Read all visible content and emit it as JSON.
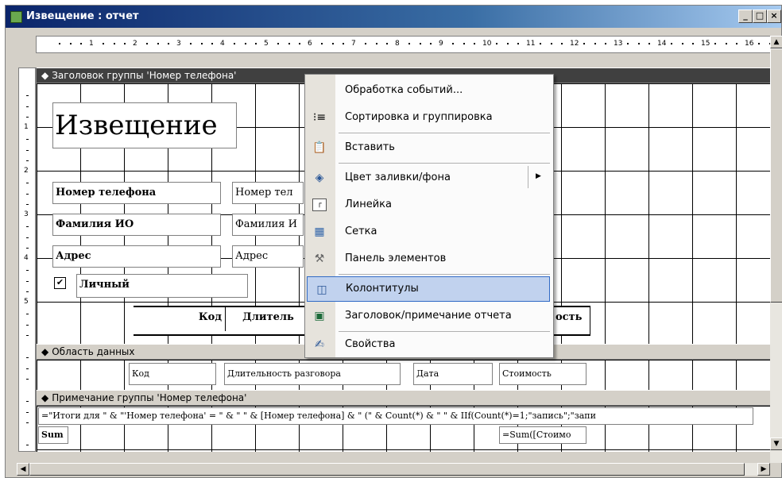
{
  "window": {
    "title": "Извещение : отчет",
    "minimize": "_",
    "maximize": "□",
    "close": "×"
  },
  "ruler": {
    "h_numbers": [
      "1",
      "2",
      "3",
      "4",
      "5",
      "6",
      "7",
      "8",
      "9",
      "10",
      "11",
      "12",
      "13",
      "14",
      "15",
      "16"
    ],
    "v_numbers": [
      "1",
      "2",
      "3",
      "4",
      "5"
    ]
  },
  "sections": {
    "group_header": "Заголовок группы 'Номер телефона'",
    "detail": "Область данных",
    "group_footer": "Примечание группы 'Номер телефона'"
  },
  "header_controls": {
    "title": "Извещение",
    "phone_label": "Номер телефона",
    "phone_field": "Номер тел",
    "name_label": "Фамилия ИО",
    "name_field": "Фамилия И",
    "address_label": "Адрес",
    "address_field": "Адрес",
    "personal_checkbox": "✔",
    "personal_label": "Личный",
    "col_code": "Код",
    "col_duration": "Длитель",
    "col_cost": "ость"
  },
  "detail_controls": {
    "code": "Код",
    "duration": "Длительность разговора",
    "date": "Дата",
    "cost": "Стоимость"
  },
  "footer_controls": {
    "expression": "=\"Итоги для \" & \"'Номер телефона' = \" & \" \" & [Номер телефона] & \" (\" & Count(*) & \" \" & IIf(Count(*)=1;\"запись\";\"запи",
    "sum_label": "Sum",
    "sum_field": "=Sum([Стоимо"
  },
  "context_menu": {
    "items": [
      {
        "label": "Обработка событий...",
        "icon": "none"
      },
      {
        "label": "Сортировка и группировка",
        "icon": "sort-group-icon"
      },
      {
        "label": "Вставить",
        "icon": "paste-icon"
      },
      {
        "label": "Цвет заливки/фона",
        "icon": "fill-color-icon",
        "submenu": "▶"
      },
      {
        "label": "Линейка",
        "icon": "ruler-icon"
      },
      {
        "label": "Сетка",
        "icon": "grid-icon"
      },
      {
        "label": "Панель элементов",
        "icon": "toolbox-icon"
      },
      {
        "label": "Колонтитулы",
        "icon": "page-header-footer-icon",
        "highlighted": true
      },
      {
        "label": "Заголовок/примечание отчета",
        "icon": "report-header-footer-icon"
      },
      {
        "label": "Свойства",
        "icon": "properties-icon"
      }
    ]
  },
  "colors": {
    "titlebar": "#0a246a",
    "menu_highlight": "#c1d2ee",
    "window_bg": "#d4d0c8"
  }
}
